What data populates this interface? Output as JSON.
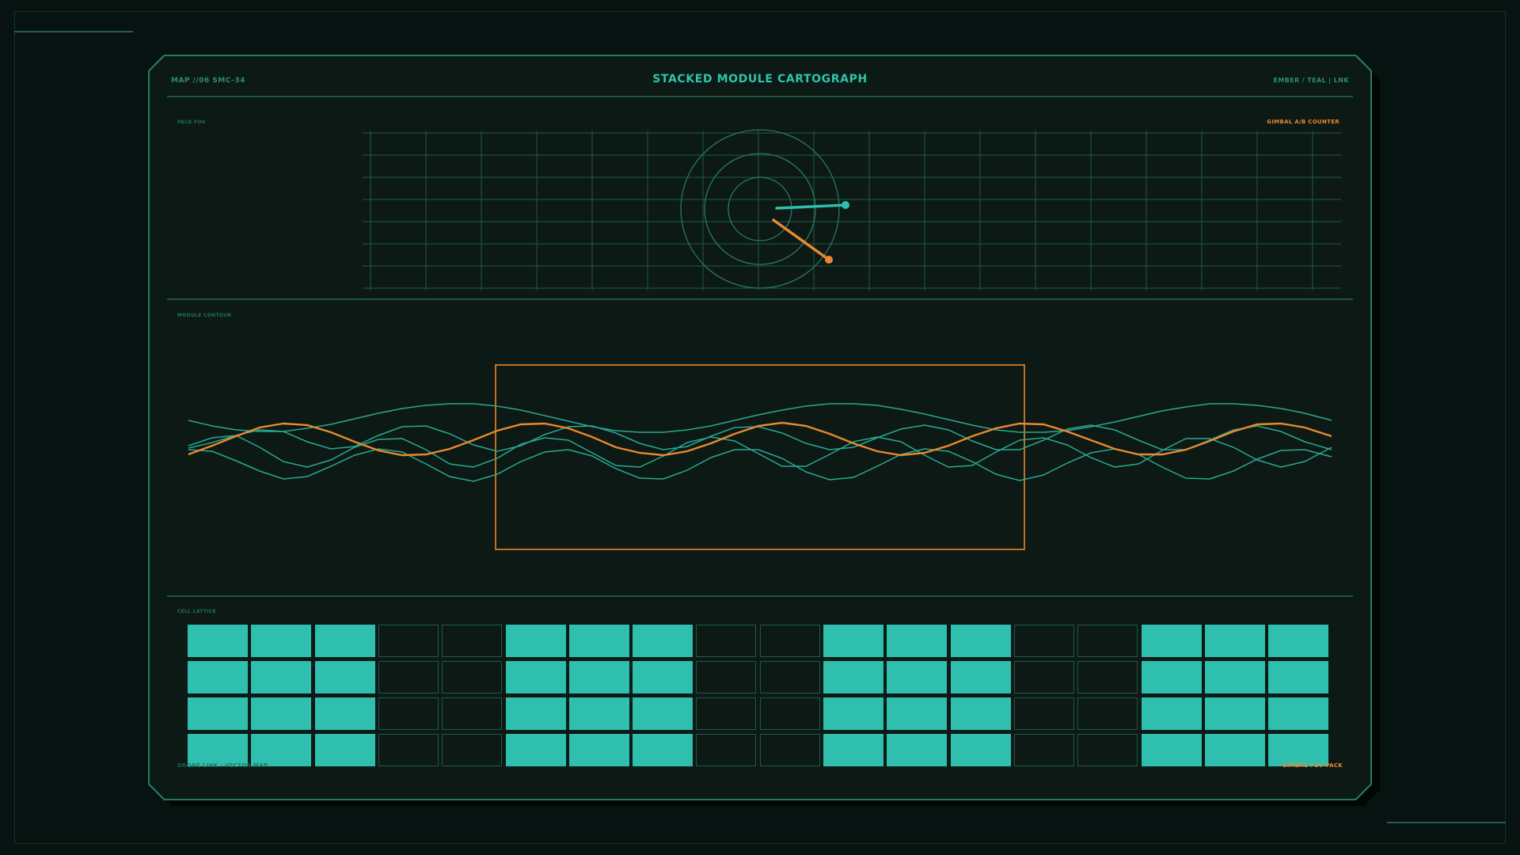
{
  "header": {
    "code": "MAP //06 SMC-34",
    "title": "STACKED MODULE CARTOGRAPH",
    "mode": "EMBER / TEAL | LNK"
  },
  "fov": {
    "label": "PACK FOV",
    "gimbal_label": "GIMBAL A/B COUNTER"
  },
  "contour": {
    "label": "MODULE CONTOUR"
  },
  "lattice": {
    "label": "CELL LATTICE",
    "rows": [
      [
        1,
        1,
        1,
        0,
        0,
        1,
        1,
        1,
        0,
        0,
        1,
        1,
        1,
        0,
        0,
        1,
        1,
        1
      ],
      [
        1,
        1,
        1,
        0,
        0,
        1,
        1,
        1,
        0,
        0,
        1,
        1,
        1,
        0,
        0,
        1,
        1,
        1
      ],
      [
        1,
        1,
        1,
        0,
        0,
        1,
        1,
        1,
        0,
        0,
        1,
        1,
        1,
        0,
        0,
        1,
        1,
        1
      ],
      [
        1,
        1,
        1,
        0,
        0,
        1,
        1,
        1,
        0,
        0,
        1,
        1,
        1,
        0,
        0,
        1,
        1,
        1
      ]
    ]
  },
  "footer": {
    "left": "DRONE LINK · VECTOR MAP",
    "right": "GIMBAL FOV PACK"
  },
  "colors": {
    "teal": "#2ebfae",
    "ember": "#e8892f",
    "grid": "#1f5a49",
    "panel": "#0c1914"
  }
}
